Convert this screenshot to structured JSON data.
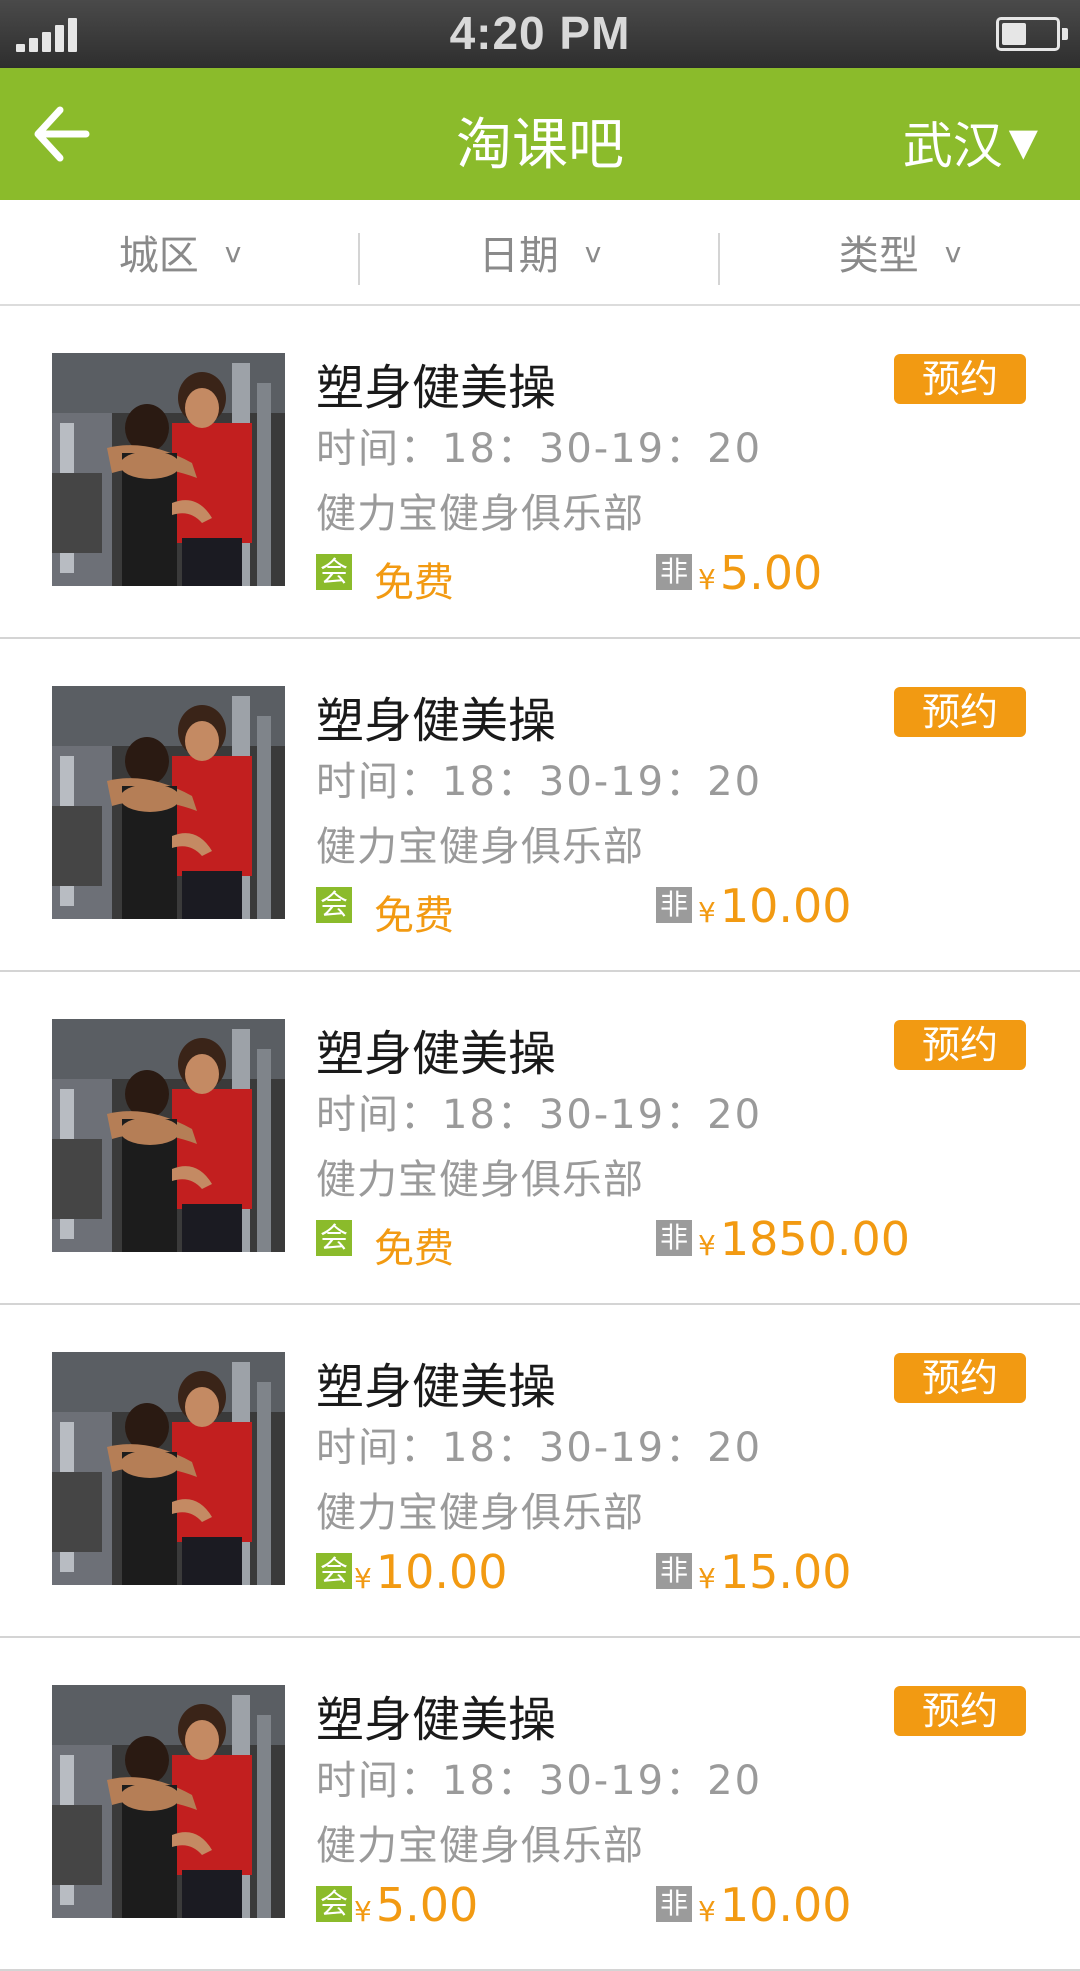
{
  "status_bar": {
    "time": "4:20 PM"
  },
  "header": {
    "title": "淘课吧",
    "city": "武汉",
    "city_arrow": "▼"
  },
  "filters": [
    {
      "label": "城区",
      "chevron": "v"
    },
    {
      "label": "日期",
      "chevron": "v"
    },
    {
      "label": "类型",
      "chevron": "v"
    }
  ],
  "badges": {
    "member": "会",
    "nonmember": "非"
  },
  "currency": "¥",
  "courses": [
    {
      "name": "塑身健美操",
      "time": "时间：18：30-19：20",
      "club": "健力宝健身俱乐部",
      "member_price": "免费",
      "member_free": true,
      "nonmember_price": "5.00",
      "book_label": "预约"
    },
    {
      "name": "塑身健美操",
      "time": "时间：18：30-19：20",
      "club": "健力宝健身俱乐部",
      "member_price": "免费",
      "member_free": true,
      "nonmember_price": "10.00",
      "book_label": "预约"
    },
    {
      "name": "塑身健美操",
      "time": "时间：18：30-19：20",
      "club": "健力宝健身俱乐部",
      "member_price": "免费",
      "member_free": true,
      "nonmember_price": "1850.00",
      "book_label": "预约"
    },
    {
      "name": "塑身健美操",
      "time": "时间：18：30-19：20",
      "club": "健力宝健身俱乐部",
      "member_price": "10.00",
      "member_free": false,
      "nonmember_price": "15.00",
      "book_label": "预约"
    },
    {
      "name": "塑身健美操",
      "time": "时间：18：30-19：20",
      "club": "健力宝健身俱乐部",
      "member_price": "5.00",
      "member_free": false,
      "nonmember_price": "10.00",
      "book_label": "预约"
    }
  ],
  "colors": {
    "brand_green": "#8bbb2b",
    "accent_orange": "#f29a12",
    "muted_gray": "#9b9b9b"
  }
}
